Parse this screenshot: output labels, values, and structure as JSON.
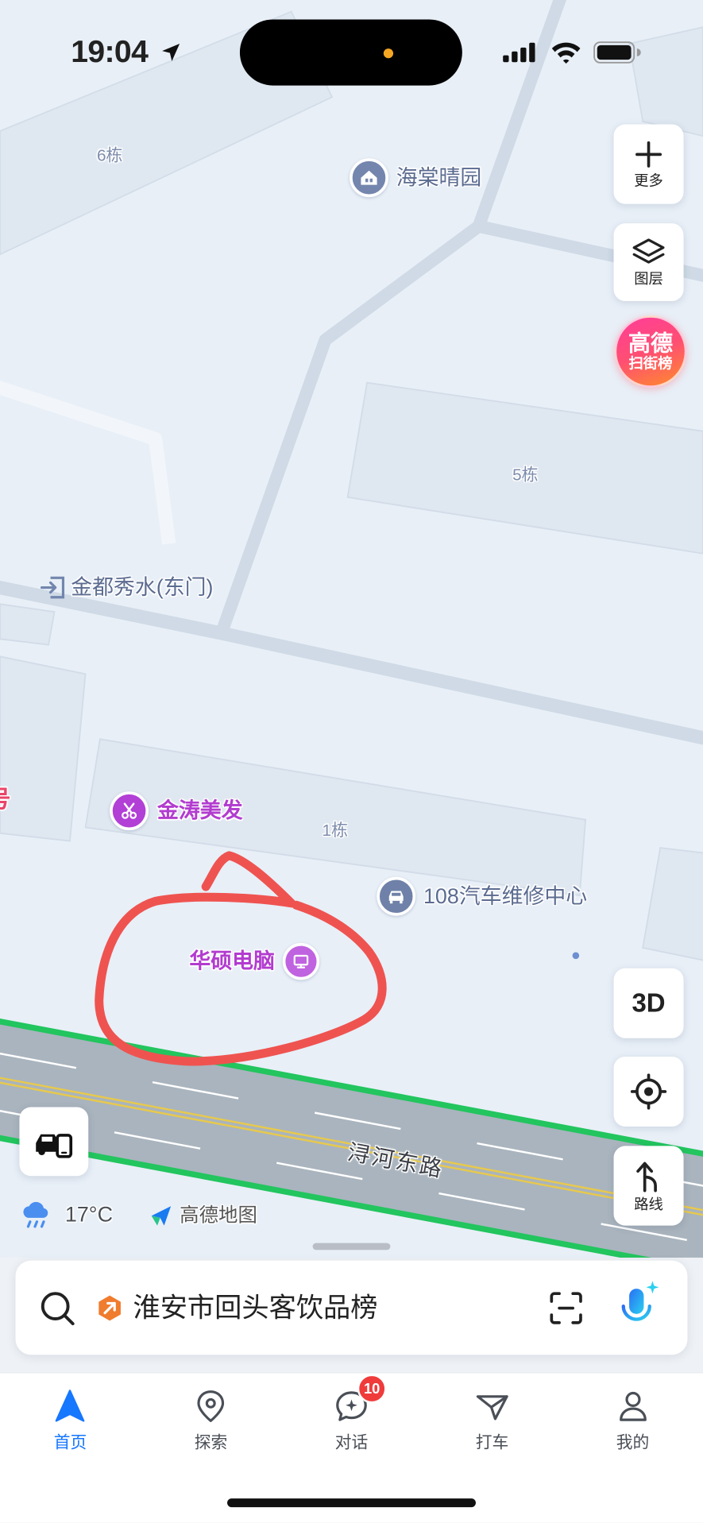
{
  "status_bar": {
    "time": "19:04",
    "location_icon": "location-arrow-icon",
    "signal_icon": "cellular-signal-icon",
    "wifi_icon": "wifi-icon",
    "battery_icon": "battery-icon"
  },
  "map": {
    "buildings": [
      {
        "label": "6栋"
      },
      {
        "label": "5栋"
      },
      {
        "label": "1栋"
      }
    ],
    "pois": [
      {
        "name": "海棠晴园",
        "icon": "residential-icon"
      },
      {
        "name": "金都秀水(东门)",
        "icon": "entrance-icon"
      },
      {
        "name": "金涛美发",
        "icon": "scissors-icon"
      },
      {
        "name": "108汽车维修中心",
        "icon": "car-icon"
      },
      {
        "name": "华硕电脑",
        "icon": "computer-icon"
      }
    ],
    "edge_label": "号",
    "road": {
      "name": "浔河东路"
    }
  },
  "map_controls": {
    "more": {
      "label": "更多",
      "icon": "plus-icon"
    },
    "layers": {
      "label": "图层",
      "icon": "layers-icon"
    },
    "ranking_badge": {
      "line1": "高德",
      "line2": "扫街榜"
    },
    "view_3d": {
      "label": "3D"
    },
    "locate": {
      "icon": "crosshair-icon"
    },
    "route": {
      "label": "路线",
      "icon": "route-icon"
    },
    "car_mode": {
      "icon": "car-phone-icon"
    }
  },
  "weather": {
    "temperature": "17°C",
    "icon": "rain-cloud-icon"
  },
  "brand": {
    "name": "高德地图",
    "icon": "amap-logo-icon"
  },
  "search": {
    "placeholder": "淮安市回头客饮品榜",
    "search_icon": "search-icon",
    "tag_icon": "hexagon-arrow-icon",
    "scan_icon": "scan-icon",
    "voice_icon": "microphone-icon"
  },
  "tab_bar": {
    "tabs": [
      {
        "label": "首页",
        "icon": "navigation-arrow-icon",
        "active": true
      },
      {
        "label": "探索",
        "icon": "location-pin-icon",
        "active": false
      },
      {
        "label": "对话",
        "icon": "chat-bubble-icon",
        "active": false,
        "badge": "10"
      },
      {
        "label": "打车",
        "icon": "taxi-icon",
        "active": false
      },
      {
        "label": "我的",
        "icon": "person-icon",
        "active": false
      }
    ]
  },
  "colors": {
    "accent": "#1677ff",
    "poi_purple": "#b23ccf",
    "road_edge_green": "#22c55e",
    "annotation_red": "#ef5350",
    "badge_red": "#f03b3b",
    "ranking_gradient_start": "#ff3d9a",
    "ranking_gradient_end": "#ff8c2b"
  }
}
